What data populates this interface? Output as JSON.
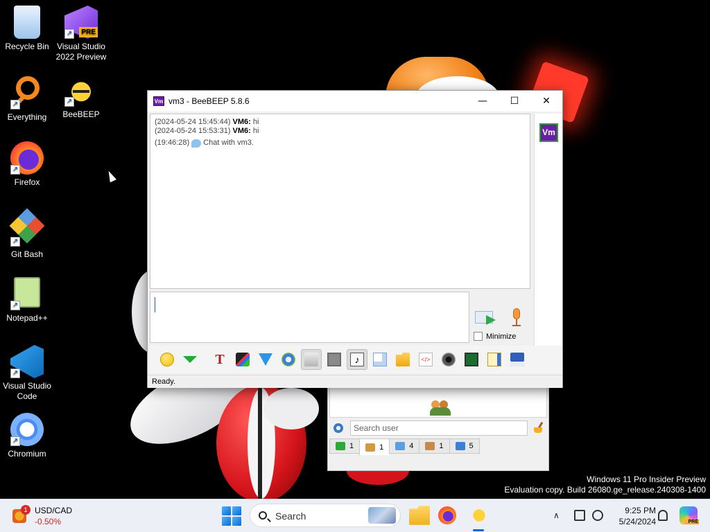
{
  "desktop": {
    "icons": [
      {
        "label": "Recycle Bin"
      },
      {
        "label": "Visual Studio 2022 Preview",
        "badge": "PRE"
      },
      {
        "label": "Everything"
      },
      {
        "label": "BeeBEEP"
      },
      {
        "label": "Firefox"
      },
      {
        "label": "Git Bash"
      },
      {
        "label": "Notepad++"
      },
      {
        "label": "Visual Studio Code"
      },
      {
        "label": "Chromium"
      }
    ],
    "watermark_line1": "Windows 11 Pro Insider Preview",
    "watermark_line2": "Evaluation copy. Build 26080.ge_release.240308-1400"
  },
  "chat_window": {
    "title": "vm3 - BeeBEEP 5.8.6",
    "app_icon_text": "Vm",
    "controls": {
      "minimize": "—",
      "maximize": "☐",
      "close": "✕"
    },
    "messages": [
      {
        "time": "(2024-05-24 15:45:44)",
        "sender": "VM6:",
        "text": "hi"
      },
      {
        "time": "(2024-05-24 15:53:31)",
        "sender": "VM6:",
        "text": "hi"
      }
    ],
    "system_message": {
      "time": "(19:46:28)",
      "text": "Chat with vm3."
    },
    "avatar_text": "Vm",
    "minimize_checkbox_label": "Minimize",
    "status": "Ready."
  },
  "main_window": {
    "search_placeholder": "Search user",
    "tabs": [
      {
        "count": "1",
        "color": "#2fa83a"
      },
      {
        "count": "1",
        "color": "#d49a40"
      },
      {
        "count": "4",
        "color": "#5aa0e0"
      },
      {
        "count": "1",
        "color": "#c88a4a"
      },
      {
        "count": "5",
        "color": "#3a7fd8"
      }
    ]
  },
  "taskbar": {
    "widget": {
      "title": "USD/CAD",
      "value": "-0.50%",
      "badge": "1"
    },
    "search_label": "Search",
    "time": "9:25 PM",
    "date": "5/24/2024",
    "copilot_badge": "PRE"
  }
}
